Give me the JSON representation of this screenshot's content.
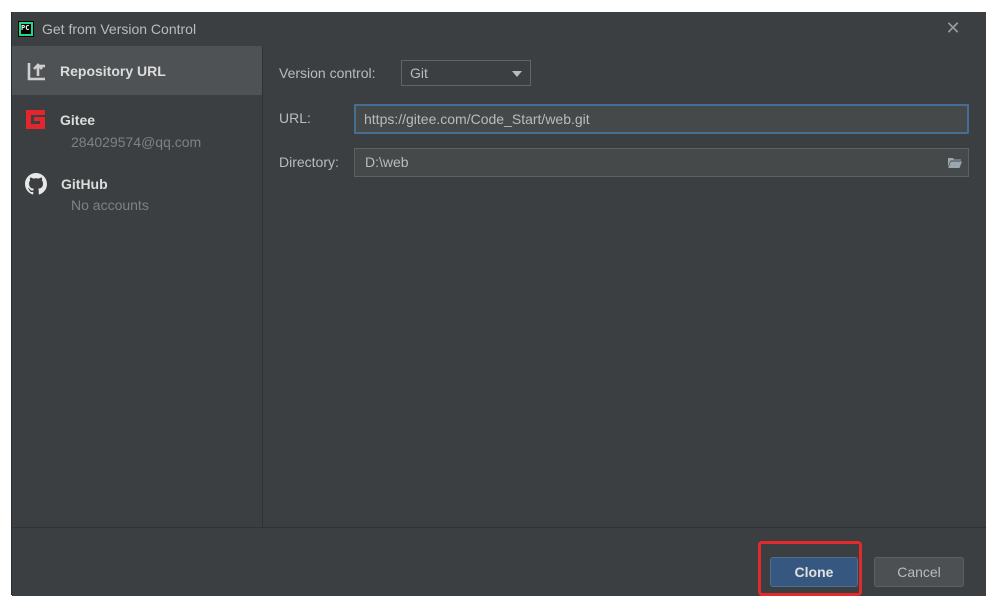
{
  "window": {
    "title": "Get from Version Control",
    "app_icon_text": "PC",
    "close_glyph": "✕"
  },
  "sidebar": {
    "items": [
      {
        "label": "Repository URL",
        "icon": "repository-url-icon",
        "selected": true
      },
      {
        "label": "Gitee",
        "sub": "284029574@qq.com",
        "icon": "gitee-icon",
        "brand_color": "#e3262b"
      },
      {
        "label": "GitHub",
        "sub": "No accounts",
        "icon": "github-icon"
      }
    ]
  },
  "form": {
    "version_control_label": "Version control:",
    "version_control_value": "Git",
    "url_label": "URL:",
    "url_value": "https://gitee.com/Code_Start/web.git",
    "directory_label": "Directory:",
    "directory_value": "D:\\web"
  },
  "footer": {
    "clone_label": "Clone",
    "cancel_label": "Cancel"
  },
  "colors": {
    "dialog_bg": "#3c3f41",
    "selected_bg": "#4e5254",
    "accent": "#365880",
    "highlight": "#e22a2a"
  }
}
